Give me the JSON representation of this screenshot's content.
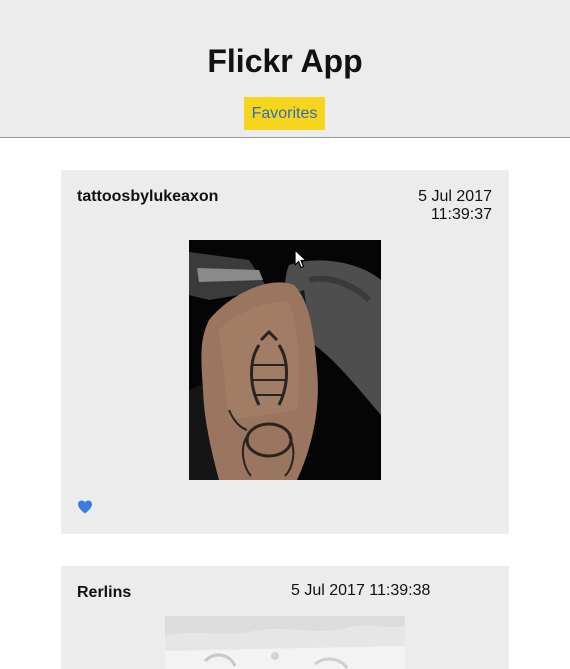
{
  "header": {
    "title": "Flickr App",
    "favorites_label": "Favorites"
  },
  "posts": [
    {
      "author": "tattoosbylukeaxon",
      "date_line1": "5 Jul 2017",
      "date_line2": "11:39:37",
      "favorited": true,
      "heart_icon": "heart-icon"
    },
    {
      "author": "Rerlins",
      "date": "5 Jul 2017 11:39:38"
    }
  ],
  "colors": {
    "header_bg": "#ececec",
    "favorites_bg": "#f7d51d",
    "favorites_text": "#2f6fb5",
    "heart": "#3a7de0"
  }
}
